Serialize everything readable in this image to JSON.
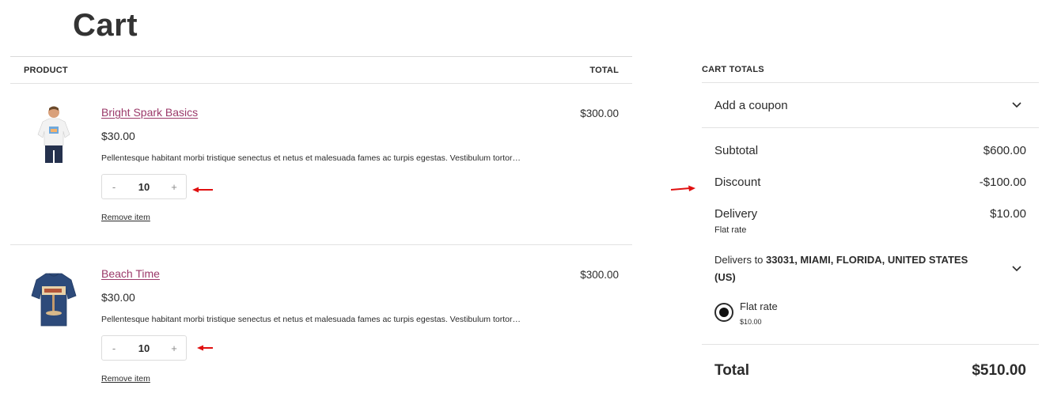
{
  "page": {
    "title": "Cart"
  },
  "table": {
    "col_product": "PRODUCT",
    "col_total": "TOTAL"
  },
  "items": [
    {
      "name": "Bright Spark Basics",
      "price": "$30.00",
      "description": "Pellentesque habitant morbi tristique senectus et netus et malesuada fames ac turpis egestas. Vestibulum tortor…",
      "qty_minus": "-",
      "quantity": "10",
      "qty_plus": "+",
      "remove_label": "Remove item",
      "line_total": "$300.00"
    },
    {
      "name": "Beach Time",
      "price": "$30.00",
      "description": "Pellentesque habitant morbi tristique senectus et netus et malesuada fames ac turpis egestas. Vestibulum tortor…",
      "qty_minus": "-",
      "quantity": "10",
      "qty_plus": "+",
      "remove_label": "Remove item",
      "line_total": "$300.00"
    }
  ],
  "totals": {
    "heading": "CART TOTALS",
    "coupon_label": "Add a coupon",
    "subtotal_label": "Subtotal",
    "subtotal_value": "$600.00",
    "discount_label": "Discount",
    "discount_value": "-$100.00",
    "delivery_label": "Delivery",
    "delivery_value": "$10.00",
    "delivery_method": "Flat rate",
    "delivers_to_prefix": "Delivers to",
    "delivers_to_address": "33031, MIAMI, FLORIDA, UNITED STATES (US)",
    "rate_option_label": "Flat rate",
    "rate_option_price": "$10.00",
    "total_label": "Total",
    "total_value": "$510.00"
  },
  "colors": {
    "link": "#9b3a6a",
    "annotation_arrow": "#e01010"
  },
  "icons": {
    "coupon_toggle": "chevron-down-icon",
    "address_toggle": "chevron-down-icon",
    "annotation": "red-arrow-icon"
  }
}
